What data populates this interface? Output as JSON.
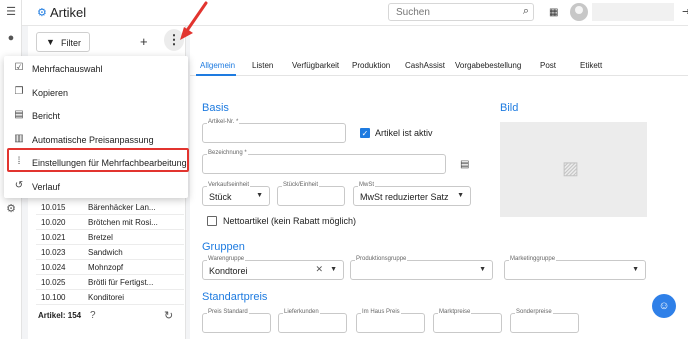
{
  "app": {
    "title": "Artikel",
    "icon": "gear-icon"
  },
  "header": {
    "search_placeholder": "Suchen"
  },
  "left": {
    "filter_label": "Filter",
    "rows": [
      {
        "nr": "10.015",
        "name": "Bärenhäcker Lan..."
      },
      {
        "nr": "10.020",
        "name": "Brötchen mit Rosi..."
      },
      {
        "nr": "10.021",
        "name": "Bretzel"
      },
      {
        "nr": "10.023",
        "name": "Sandwich"
      },
      {
        "nr": "10.024",
        "name": "Mohnzopf"
      },
      {
        "nr": "10.025",
        "name": "Brötli für Fertigst..."
      },
      {
        "nr": "10.100",
        "name": "Konditorei"
      }
    ],
    "count_label": "Artikel: 154"
  },
  "menu": {
    "items": [
      {
        "label": "Mehrfachauswahl",
        "icon": "checkbox-list-icon"
      },
      {
        "label": "Kopieren",
        "icon": "copy-icon"
      },
      {
        "label": "Bericht",
        "icon": "report-icon"
      },
      {
        "label": "Automatische Preisanpassung",
        "icon": "document-icon"
      },
      {
        "label": "Einstellungen für Mehrfachbearbeitung",
        "icon": "multi-edit-settings-icon"
      },
      {
        "label": "Verlauf",
        "icon": "history-icon"
      }
    ],
    "highlighted_index": 4
  },
  "tabs": [
    "Allgemein",
    "Listen",
    "Verfügbarkeit",
    "Produktion",
    "CashAssist",
    "Vorgabebestellung",
    "Post",
    "Etikett"
  ],
  "active_tab": "Allgemein",
  "form": {
    "basis_title": "Basis",
    "bild_title": "Bild",
    "artikel_nr_label": "Artikel-Nr. *",
    "aktiv_label": "Artikel ist aktiv",
    "aktiv_checked": true,
    "bezeichnung_label": "Bezeichnung *",
    "verkaufseinheit_label": "Verkaufseinheit",
    "verkaufseinheit_value": "Stück",
    "stueck_einheit_label": "Stück/Einheit",
    "mwst_label": "MwSt",
    "mwst_value": "MwSt reduzierter Satz",
    "netto_label": "Nettoartikel (kein Rabatt möglich)",
    "netto_checked": false,
    "gruppen_title": "Gruppen",
    "warengruppe_label": "Warengruppe",
    "warengruppe_value": "Kondtorei",
    "produktionsgruppe_label": "Produktionsgruppe",
    "marketinggruppe_label": "Marketinggruppe",
    "standardpreis_title": "Standartpreis",
    "preis_labels": [
      "Preis Standard",
      "Lieferkunden",
      "Im Haus Preis",
      "Marktpreise",
      "Sonderpreise"
    ]
  },
  "colors": {
    "accent": "#1e7be0",
    "highlight": "#e2342f"
  }
}
